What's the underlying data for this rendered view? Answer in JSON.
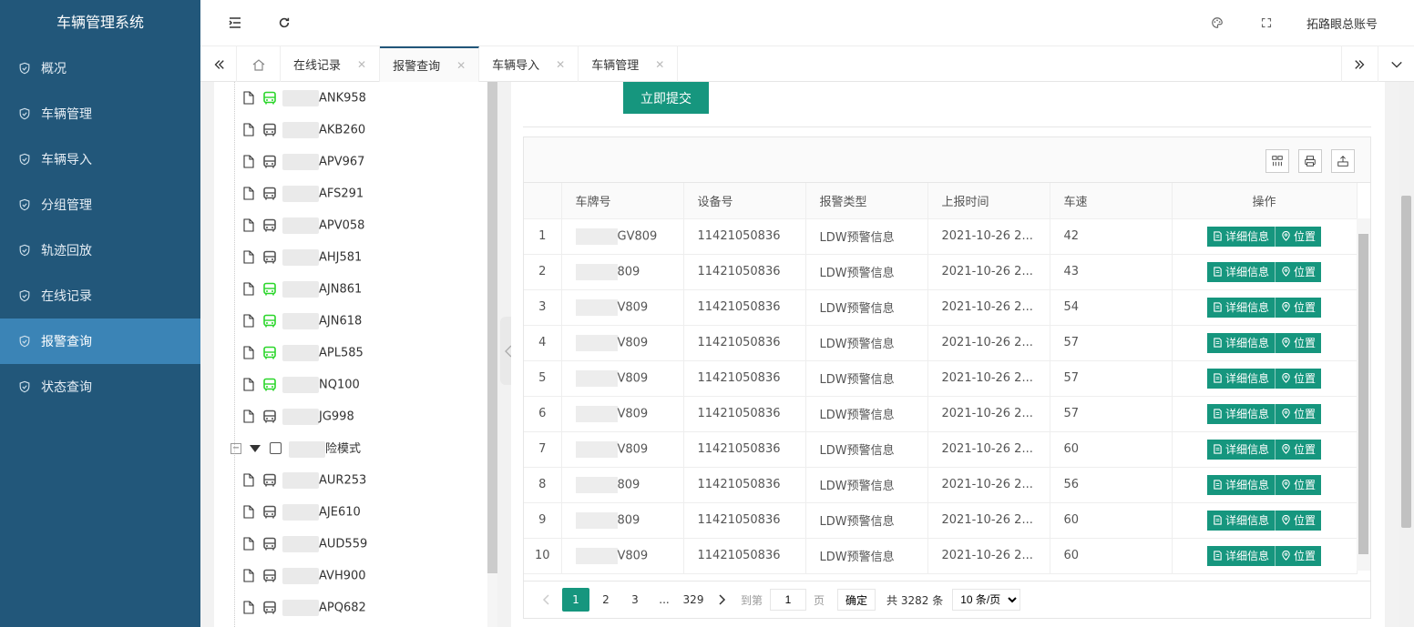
{
  "app": {
    "title": "车辆管理系统",
    "account": "拓路眼总账号"
  },
  "sidebar": {
    "items": [
      {
        "label": "概况",
        "active": false
      },
      {
        "label": "车辆管理",
        "active": false
      },
      {
        "label": "车辆导入",
        "active": false
      },
      {
        "label": "分组管理",
        "active": false
      },
      {
        "label": "轨迹回放",
        "active": false
      },
      {
        "label": "在线记录",
        "active": false
      },
      {
        "label": "报警查询",
        "active": true
      },
      {
        "label": "状态查询",
        "active": false
      }
    ]
  },
  "tabs": [
    {
      "label": "在线记录",
      "active": false
    },
    {
      "label": "报警查询",
      "active": true
    },
    {
      "label": "车辆导入",
      "active": false
    },
    {
      "label": "车辆管理",
      "active": false
    }
  ],
  "tree": {
    "vehicles": [
      {
        "plate": "ANK958",
        "online": true
      },
      {
        "plate": "AKB260",
        "online": false
      },
      {
        "plate": "APV967",
        "online": false
      },
      {
        "plate": "AFS291",
        "online": false
      },
      {
        "plate": "APV058",
        "online": false
      },
      {
        "plate": "AHJ581",
        "online": false
      },
      {
        "plate": "AJN861",
        "online": true
      },
      {
        "plate": "AJN618",
        "online": true
      },
      {
        "plate": "APL585",
        "online": true
      },
      {
        "plate": "NQ100",
        "online": true
      },
      {
        "plate": "JG998",
        "online": false
      }
    ],
    "group": {
      "label": "险模式"
    },
    "group_vehicles": [
      {
        "plate": "AUR253",
        "online": false
      },
      {
        "plate": "AJE610",
        "online": false
      },
      {
        "plate": "AUD559",
        "online": false
      },
      {
        "plate": "AVH900",
        "online": false
      },
      {
        "plate": "APQ682",
        "online": false
      }
    ]
  },
  "form": {
    "submit_label": "立即提交"
  },
  "table": {
    "columns": [
      "",
      "车牌号",
      "设备号",
      "报警类型",
      "上报时间",
      "车速",
      "操作"
    ],
    "rows": [
      {
        "idx": "1",
        "plate": "GV809",
        "device": "11421050836",
        "type": "LDW预警信息",
        "time": "2021-10-26 2...",
        "speed": "42"
      },
      {
        "idx": "2",
        "plate": "809",
        "device": "11421050836",
        "type": "LDW预警信息",
        "time": "2021-10-26 2...",
        "speed": "43"
      },
      {
        "idx": "3",
        "plate": "V809",
        "device": "11421050836",
        "type": "LDW预警信息",
        "time": "2021-10-26 2...",
        "speed": "54"
      },
      {
        "idx": "4",
        "plate": "V809",
        "device": "11421050836",
        "type": "LDW预警信息",
        "time": "2021-10-26 2...",
        "speed": "57"
      },
      {
        "idx": "5",
        "plate": "V809",
        "device": "11421050836",
        "type": "LDW预警信息",
        "time": "2021-10-26 2...",
        "speed": "57"
      },
      {
        "idx": "6",
        "plate": "V809",
        "device": "11421050836",
        "type": "LDW预警信息",
        "time": "2021-10-26 2...",
        "speed": "57"
      },
      {
        "idx": "7",
        "plate": "V809",
        "device": "11421050836",
        "type": "LDW预警信息",
        "time": "2021-10-26 2...",
        "speed": "60"
      },
      {
        "idx": "8",
        "plate": "809",
        "device": "11421050836",
        "type": "LDW预警信息",
        "time": "2021-10-26 2...",
        "speed": "56"
      },
      {
        "idx": "9",
        "plate": "809",
        "device": "11421050836",
        "type": "LDW预警信息",
        "time": "2021-10-26 2...",
        "speed": "60"
      },
      {
        "idx": "10",
        "plate": "V809",
        "device": "11421050836",
        "type": "LDW预警信息",
        "time": "2021-10-26 2...",
        "speed": "60"
      }
    ],
    "actions": {
      "detail": "详细信息",
      "location": "位置"
    }
  },
  "pager": {
    "pages": [
      "1",
      "2",
      "3",
      "...",
      "329"
    ],
    "current": "1",
    "goto_prefix": "到第",
    "goto_value": "1",
    "goto_suffix": "页",
    "confirm": "确定",
    "total": "共 3282 条",
    "page_size": "10 条/页"
  },
  "colors": {
    "sidebar": "#22577a",
    "sidebar_active": "#3b84b6",
    "primary": "#16967e",
    "online": "#2bd62b",
    "offline": "#555555"
  }
}
